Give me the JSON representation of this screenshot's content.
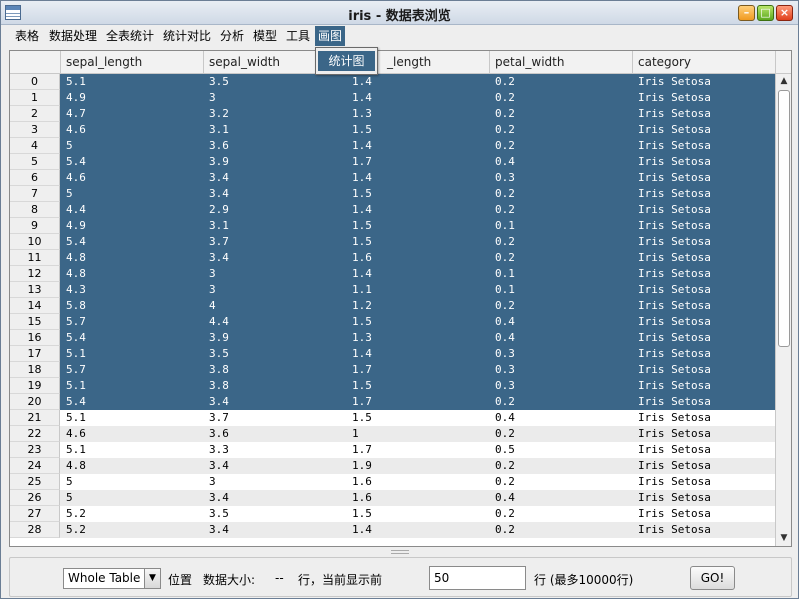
{
  "window": {
    "title": "iris - 数据表浏览"
  },
  "menu": [
    {
      "label": "表格"
    },
    {
      "label": "数据处理"
    },
    {
      "label": "全表统计"
    },
    {
      "label": "统计对比"
    },
    {
      "label": "分析"
    },
    {
      "label": "模型"
    },
    {
      "label": "工具"
    },
    {
      "label": "画图"
    }
  ],
  "dropdown": {
    "item": "统计图"
  },
  "table": {
    "columns": [
      "sepal_length",
      "sepal_width",
      "_length",
      "petal_width",
      "category"
    ],
    "selected_rows": 21,
    "rows": [
      [
        "0",
        "5.1",
        "3.5",
        "1.4",
        "0.2",
        "Iris Setosa"
      ],
      [
        "1",
        "4.9",
        "3",
        "1.4",
        "0.2",
        "Iris Setosa"
      ],
      [
        "2",
        "4.7",
        "3.2",
        "1.3",
        "0.2",
        "Iris Setosa"
      ],
      [
        "3",
        "4.6",
        "3.1",
        "1.5",
        "0.2",
        "Iris Setosa"
      ],
      [
        "4",
        "5",
        "3.6",
        "1.4",
        "0.2",
        "Iris Setosa"
      ],
      [
        "5",
        "5.4",
        "3.9",
        "1.7",
        "0.4",
        "Iris Setosa"
      ],
      [
        "6",
        "4.6",
        "3.4",
        "1.4",
        "0.3",
        "Iris Setosa"
      ],
      [
        "7",
        "5",
        "3.4",
        "1.5",
        "0.2",
        "Iris Setosa"
      ],
      [
        "8",
        "4.4",
        "2.9",
        "1.4",
        "0.2",
        "Iris Setosa"
      ],
      [
        "9",
        "4.9",
        "3.1",
        "1.5",
        "0.1",
        "Iris Setosa"
      ],
      [
        "10",
        "5.4",
        "3.7",
        "1.5",
        "0.2",
        "Iris Setosa"
      ],
      [
        "11",
        "4.8",
        "3.4",
        "1.6",
        "0.2",
        "Iris Setosa"
      ],
      [
        "12",
        "4.8",
        "3",
        "1.4",
        "0.1",
        "Iris Setosa"
      ],
      [
        "13",
        "4.3",
        "3",
        "1.1",
        "0.1",
        "Iris Setosa"
      ],
      [
        "14",
        "5.8",
        "4",
        "1.2",
        "0.2",
        "Iris Setosa"
      ],
      [
        "15",
        "5.7",
        "4.4",
        "1.5",
        "0.4",
        "Iris Setosa"
      ],
      [
        "16",
        "5.4",
        "3.9",
        "1.3",
        "0.4",
        "Iris Setosa"
      ],
      [
        "17",
        "5.1",
        "3.5",
        "1.4",
        "0.3",
        "Iris Setosa"
      ],
      [
        "18",
        "5.7",
        "3.8",
        "1.7",
        "0.3",
        "Iris Setosa"
      ],
      [
        "19",
        "5.1",
        "3.8",
        "1.5",
        "0.3",
        "Iris Setosa"
      ],
      [
        "20",
        "5.4",
        "3.4",
        "1.7",
        "0.2",
        "Iris Setosa"
      ],
      [
        "21",
        "5.1",
        "3.7",
        "1.5",
        "0.4",
        "Iris Setosa"
      ],
      [
        "22",
        "4.6",
        "3.6",
        "1",
        "0.2",
        "Iris Setosa"
      ],
      [
        "23",
        "5.1",
        "3.3",
        "1.7",
        "0.5",
        "Iris Setosa"
      ],
      [
        "24",
        "4.8",
        "3.4",
        "1.9",
        "0.2",
        "Iris Setosa"
      ],
      [
        "25",
        "5",
        "3",
        "1.6",
        "0.2",
        "Iris Setosa"
      ],
      [
        "26",
        "5",
        "3.4",
        "1.6",
        "0.4",
        "Iris Setosa"
      ],
      [
        "27",
        "5.2",
        "3.5",
        "1.5",
        "0.2",
        "Iris Setosa"
      ],
      [
        "28",
        "5.2",
        "3.4",
        "1.4",
        "0.2",
        "Iris Setosa"
      ]
    ]
  },
  "bottom": {
    "scope_select": "Whole Table",
    "position_label": "位置",
    "size_label": "数据大小:",
    "size_value": "--",
    "rows_label": "行，当前显示前",
    "show_count": "50",
    "max_label": "行 (最多10000行)",
    "go_label": "GO!"
  },
  "colors": {
    "selection": "#3b6688",
    "row_alt": "#ebebeb"
  },
  "icons": [
    "table-icon",
    "minimize-icon",
    "maximize-icon",
    "close-icon",
    "scroll-up-icon",
    "scroll-down-icon",
    "dropdown-arrow-icon"
  ]
}
